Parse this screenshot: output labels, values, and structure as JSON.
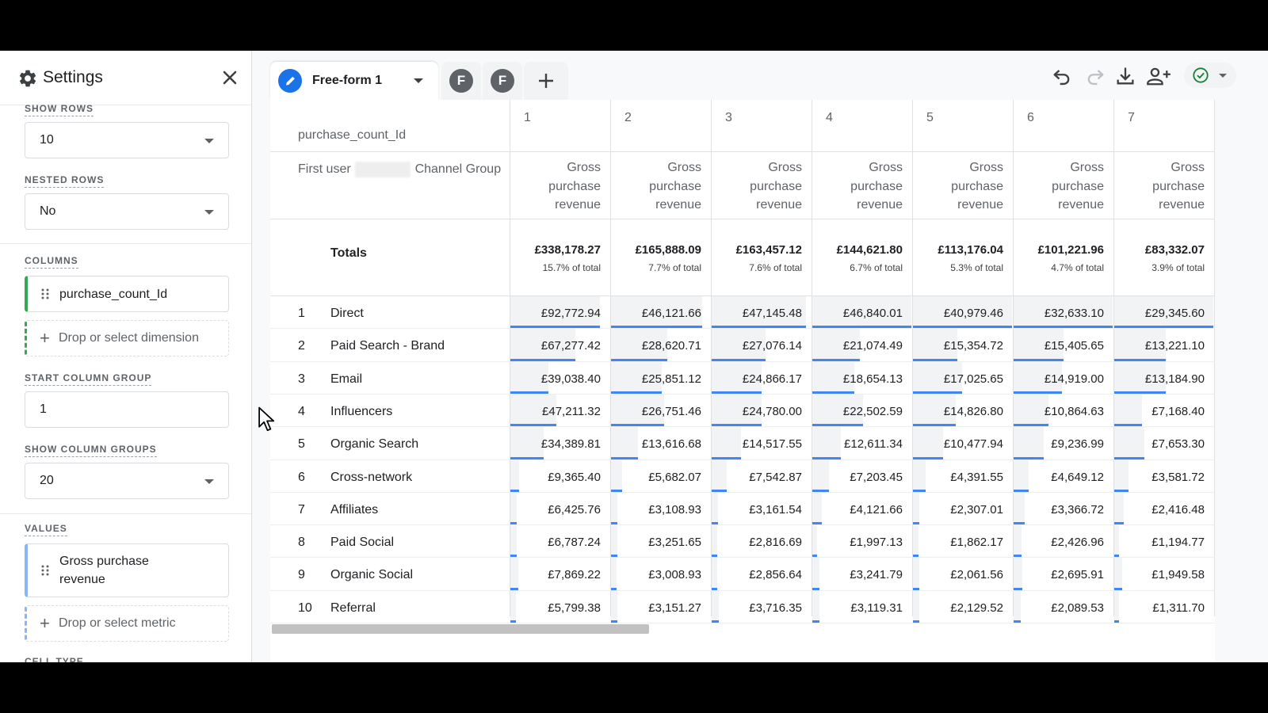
{
  "settings": {
    "title": "Settings",
    "show_rows": {
      "label": "SHOW ROWS",
      "value": "10"
    },
    "nested_rows": {
      "label": "NESTED ROWS",
      "value": "No"
    },
    "columns": {
      "label": "COLUMNS",
      "item": "purchase_count_Id",
      "drop": "Drop or select dimension"
    },
    "start_column_group": {
      "label": "START COLUMN GROUP",
      "value": "1"
    },
    "show_column_groups": {
      "label": "SHOW COLUMN GROUPS",
      "value": "20"
    },
    "values": {
      "label": "VALUES",
      "item_line1": "Gross purchase",
      "item_line2": "revenue",
      "drop": "Drop or select metric"
    },
    "cell_type": {
      "label": "CELL TYPE"
    }
  },
  "tabs": {
    "active": "Free-form 1",
    "others": [
      "F",
      "F"
    ]
  },
  "table": {
    "column_dimension": "purchase_count_Id",
    "row_dimension_prefix": "First user",
    "row_dimension_suffix": "Channel Group",
    "metric_lines": [
      "Gross",
      "purchase",
      "revenue"
    ],
    "totals_label": "Totals",
    "columns": [
      "1",
      "2",
      "3",
      "4",
      "5",
      "6",
      "7"
    ],
    "totals": [
      "£338,178.27",
      "£165,888.09",
      "£163,457.12",
      "£144,621.80",
      "£113,176.04",
      "£101,221.96",
      "£83,332.07"
    ],
    "totals_pct": [
      "15.7% of total",
      "7.7% of total",
      "7.6% of total",
      "6.7% of total",
      "5.3% of total",
      "4.7% of total",
      "3.9% of total"
    ],
    "rows": [
      {
        "n": "1",
        "name": "Direct",
        "values": [
          "£92,772.94",
          "£46,121.66",
          "£47,145.48",
          "£46,840.01",
          "£40,979.46",
          "£32,633.10",
          "£29,345.60"
        ]
      },
      {
        "n": "2",
        "name": "Paid Search - Brand",
        "values": [
          "£67,277.42",
          "£28,620.71",
          "£27,076.14",
          "£21,074.49",
          "£15,354.72",
          "£15,405.65",
          "£13,221.10"
        ]
      },
      {
        "n": "3",
        "name": "Email",
        "values": [
          "£39,038.40",
          "£25,851.12",
          "£24,866.17",
          "£18,654.13",
          "£17,025.65",
          "£14,919.00",
          "£13,184.90"
        ]
      },
      {
        "n": "4",
        "name": "Influencers",
        "values": [
          "£47,211.32",
          "£26,751.46",
          "£24,780.00",
          "£22,502.59",
          "£14,826.80",
          "£10,864.63",
          "£7,168.40"
        ]
      },
      {
        "n": "5",
        "name": "Organic Search",
        "values": [
          "£34,389.81",
          "£13,616.68",
          "£14,517.55",
          "£12,611.34",
          "£10,477.94",
          "£9,236.99",
          "£7,653.30"
        ]
      },
      {
        "n": "6",
        "name": "Cross-network",
        "values": [
          "£9,365.40",
          "£5,682.07",
          "£7,542.87",
          "£7,203.45",
          "£4,391.55",
          "£4,649.12",
          "£3,581.72"
        ]
      },
      {
        "n": "7",
        "name": "Affiliates",
        "values": [
          "£6,425.76",
          "£3,108.93",
          "£3,161.54",
          "£4,121.66",
          "£2,307.01",
          "£3,366.72",
          "£2,416.48"
        ]
      },
      {
        "n": "8",
        "name": "Paid Social",
        "values": [
          "£6,787.24",
          "£3,251.65",
          "£2,816.69",
          "£1,997.13",
          "£1,862.17",
          "£2,426.96",
          "£1,194.77"
        ]
      },
      {
        "n": "9",
        "name": "Organic Social",
        "values": [
          "£7,869.22",
          "£3,008.93",
          "£2,856.64",
          "£3,241.79",
          "£2,061.56",
          "£2,695.91",
          "£1,949.58"
        ]
      },
      {
        "n": "10",
        "name": "Referral",
        "values": [
          "£5,799.38",
          "£3,151.27",
          "£3,716.35",
          "£3,119.31",
          "£2,129.52",
          "£2,089.53",
          "£1,311.70"
        ]
      }
    ]
  },
  "colors": {
    "accent": "#1a73e8",
    "bar": "#4285f4",
    "column_chip": "#34a853",
    "metric_chip": "#8ab4f8"
  },
  "icons": [
    "gear-icon",
    "close-icon",
    "pencil-icon",
    "plus-icon",
    "undo-icon",
    "redo-icon",
    "download-icon",
    "share-icon",
    "check-circle-icon",
    "drag-handle-icon",
    "cursor-icon"
  ]
}
